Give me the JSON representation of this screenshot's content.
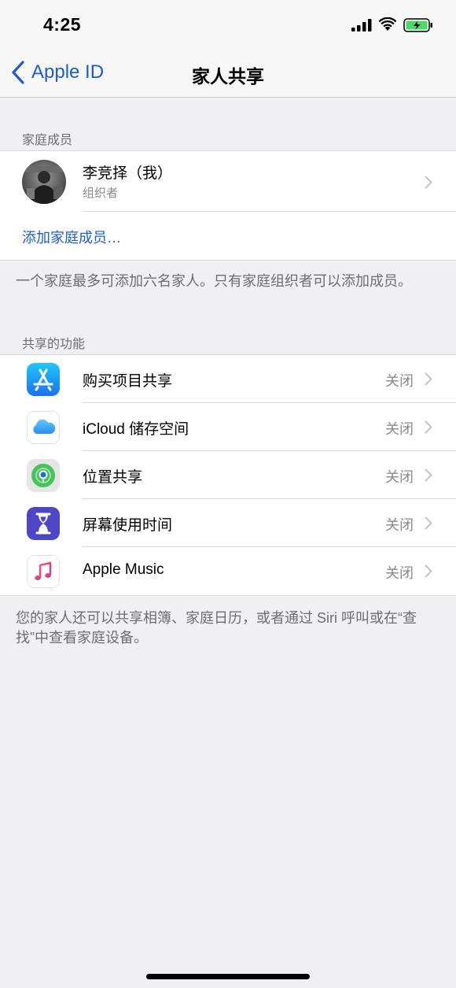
{
  "status_bar": {
    "time": "4:25",
    "battery_color": "#4cd964"
  },
  "nav": {
    "back_label": "Apple ID",
    "title": "家人共享"
  },
  "family_section": {
    "header": "家庭成员",
    "member": {
      "name": "李竞择（我）",
      "role": "组织者"
    },
    "add_label": "添加家庭成员…",
    "footer": "一个家庭最多可添加六名家人。只有家庭组织者可以添加成员。"
  },
  "features_section": {
    "header": "共享的功能",
    "items": [
      {
        "label": "购买项目共享",
        "status": "关闭",
        "icon": "app-store-icon"
      },
      {
        "label": "iCloud 储存空间",
        "status": "关闭",
        "icon": "icloud-icon"
      },
      {
        "label": "位置共享",
        "status": "关闭",
        "icon": "find-my-icon"
      },
      {
        "label": "屏幕使用时间",
        "status": "关闭",
        "icon": "screen-time-icon"
      },
      {
        "label": "Apple Music",
        "status": "关闭",
        "icon": "apple-music-icon"
      }
    ],
    "footer": "您的家人还可以共享相簿、家庭日历，或者通过 Siri 呼叫或在“查找”中查看家庭设备。"
  },
  "colors": {
    "accent": "#1e5bd6",
    "background": "#efeff4"
  }
}
